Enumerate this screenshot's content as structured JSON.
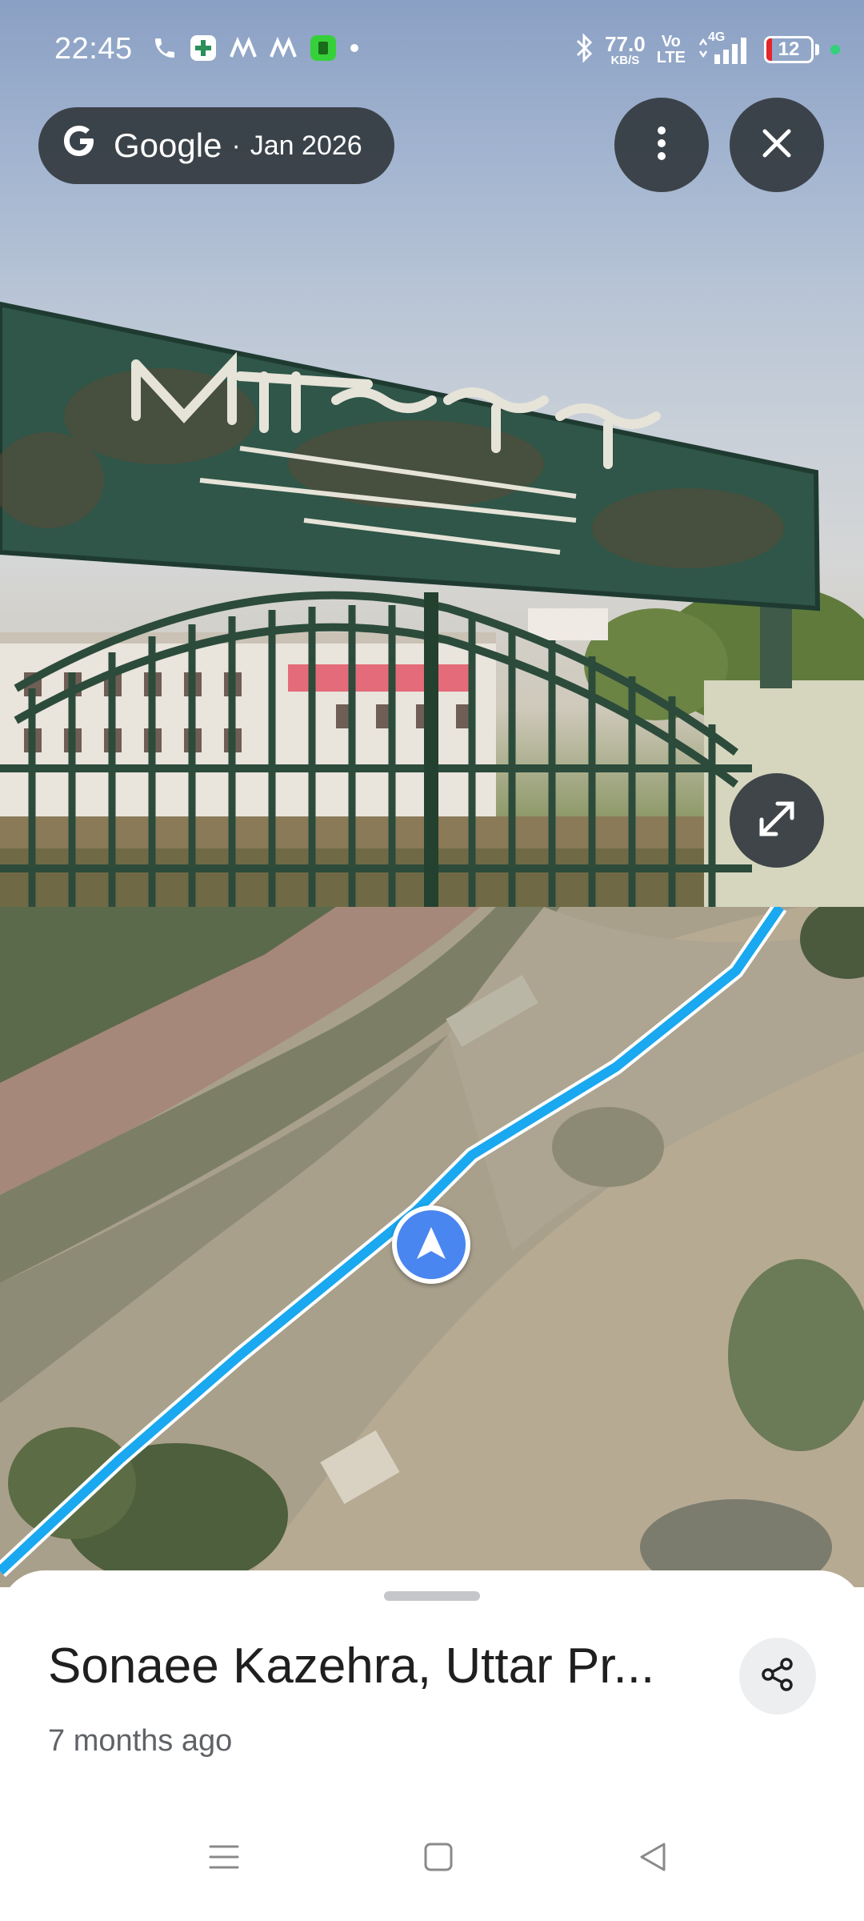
{
  "status_bar": {
    "time": "22:45",
    "left_icons": [
      "phone-icon",
      "plus-app-icon",
      "m-app-icon",
      "m-app-icon",
      "green-app-icon",
      "dot-icon"
    ],
    "net_speed_value": "77.0",
    "net_speed_unit": "KB/S",
    "volte_top": "Vo",
    "volte_bottom": "LTE",
    "network": "4G",
    "battery_level": "12",
    "battery_fraction": 0.12,
    "battery_color": "#e5252b"
  },
  "imagery": {
    "provider": "Google",
    "date": "Jan 2026",
    "separator": "·"
  },
  "place": {
    "title": "Sonaee Kazehra, Uttar Pr...",
    "subtitle": "7 months ago"
  },
  "colors": {
    "route": "#1aa8f0",
    "marker": "#4a86f0"
  },
  "icons": {
    "more": "more-vertical-icon",
    "close": "close-icon",
    "expand": "expand-icon",
    "share": "share-icon",
    "navigation": "navigation-arrow-icon"
  },
  "nav_bar": [
    "menu-icon",
    "home-icon",
    "back-icon"
  ]
}
